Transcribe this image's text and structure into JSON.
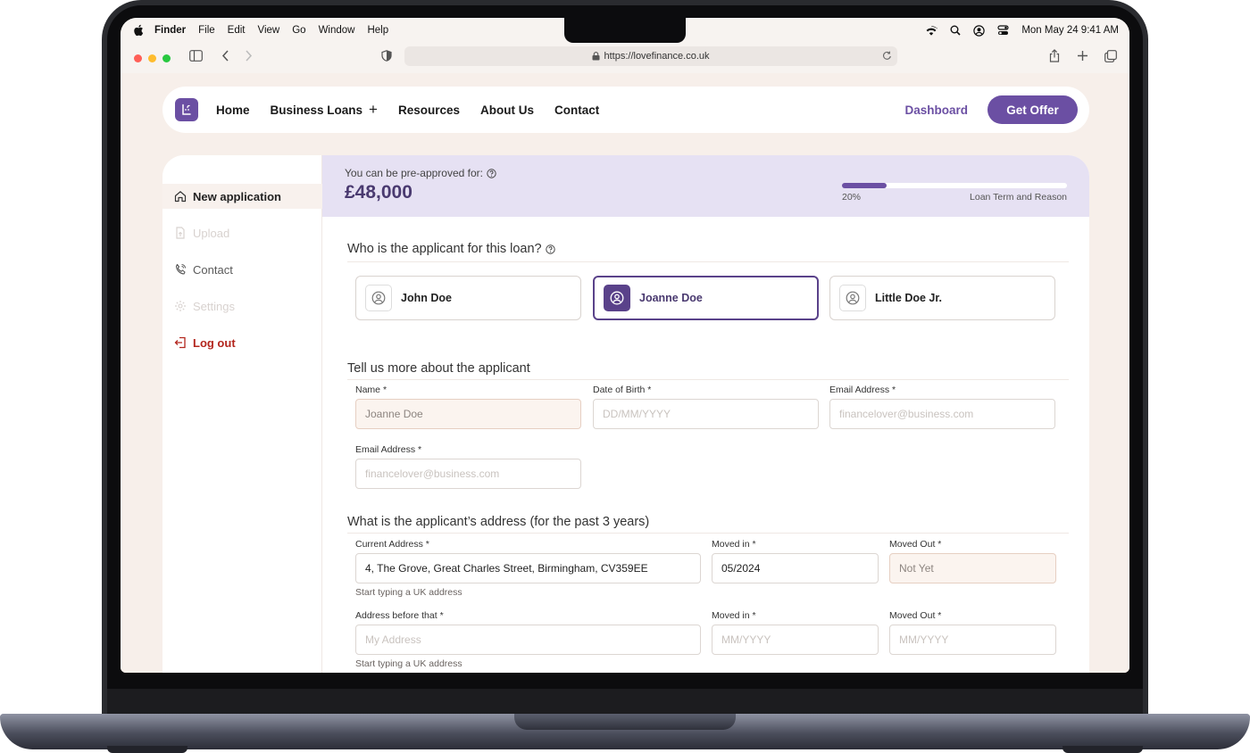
{
  "system_menu": {
    "app": "Finder",
    "items": [
      "File",
      "Edit",
      "View",
      "Go",
      "Window",
      "Help"
    ],
    "clock": "Mon May 24  9:41 AM"
  },
  "browser": {
    "url": "https://lovefinance.co.uk"
  },
  "nav": {
    "links": [
      "Home",
      "Business Loans",
      "Resources",
      "About Us",
      "Contact"
    ],
    "dashboard": "Dashboard",
    "cta": "Get Offer"
  },
  "sidebar": {
    "items": [
      {
        "label": "New application",
        "state": "active",
        "icon": "home-icon"
      },
      {
        "label": "Upload",
        "state": "disabled",
        "icon": "upload-icon"
      },
      {
        "label": "Contact",
        "state": "normal",
        "icon": "phone-icon"
      },
      {
        "label": "Settings",
        "state": "disabled",
        "icon": "gear-icon"
      },
      {
        "label": "Log out",
        "state": "danger",
        "icon": "logout-icon"
      }
    ]
  },
  "banner": {
    "label": "You can be pre-approved for:",
    "amount": "£48,000",
    "progress_percent": 20,
    "progress_label": "20%",
    "step": "Loan Term and Reason"
  },
  "applicant_section": {
    "title": "Who is the applicant for this loan?",
    "options": [
      "John Doe",
      "Joanne Doe",
      "Little Doe Jr."
    ],
    "selected": "Joanne Doe"
  },
  "details_section": {
    "title": "Tell us more about the applicant",
    "name_label": "Name",
    "name_value": "Joanne Doe",
    "dob_label": "Date of Birth",
    "dob_placeholder": "DD/MM/YYYY",
    "email_label": "Email Address",
    "email_placeholder": "financelover@business.com",
    "email2_label": "Email Address",
    "email2_placeholder": "financelover@business.com"
  },
  "address_section": {
    "title": "What is the applicant’s address (for the past 3 years)",
    "current_label": "Current Address",
    "current_value": "4, The Grove, Great Charles Street, Birmingham, CV359EE",
    "moved_in_label": "Moved in",
    "moved_in_value": "05/2024",
    "moved_out_label": "Moved Out",
    "moved_out_value": "Not Yet",
    "hint": "Start typing a UK address",
    "prev_label": "Address before that",
    "prev_placeholder": "My Address",
    "prev_moved_in_label": "Moved in",
    "prev_moved_in_placeholder": "MM/YYYY",
    "prev_moved_out_label": "Moved Out",
    "prev_moved_out_placeholder": "MM/YYYY",
    "prev_hint": "Start typing a UK address"
  },
  "required_marker": "*",
  "colors": {
    "brand": "#6b4fa3",
    "brand_dark": "#4a3a70",
    "banner_bg": "#e6e1f3",
    "page_bg": "#f7efea",
    "danger": "#b3261e"
  }
}
